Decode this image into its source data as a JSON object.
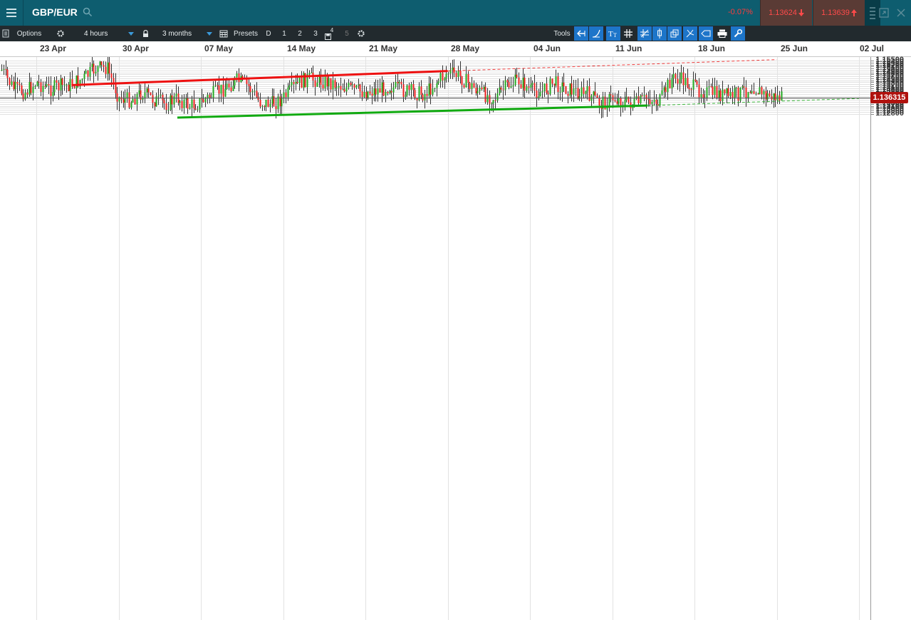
{
  "header": {
    "symbol": "GBP/EUR",
    "change": "-0.07%",
    "bid": "1.13624",
    "ask": "1.13639"
  },
  "toolbar": {
    "options_label": "Options",
    "interval_value": "4 hours",
    "range_value": "3 months",
    "presets_label": "Presets",
    "preset_buttons": [
      "D",
      "1",
      "2",
      "3",
      "4",
      "5"
    ],
    "tools_label": "Tools"
  },
  "date_axis": {
    "labels": [
      "23 Apr",
      "30 Apr",
      "07 May",
      "14 May",
      "21 May",
      "28 May",
      "04 Jun",
      "11 Jun",
      "18 Jun",
      "25 Jun",
      "02 Jul"
    ]
  },
  "price_axis": {
    "labels": [
      "1.15500",
      "1.15400",
      "1.15300",
      "1.15200",
      "1.15100",
      "1.15000",
      "1.14900",
      "1.14800",
      "1.14700",
      "1.14600",
      "1.14500",
      "1.14400",
      "1.14300",
      "1.14200",
      "1.14100",
      "1.14000",
      "1.13900",
      "1.13800",
      "1.13700",
      "1.13600",
      "1.13500",
      "1.13400",
      "1.13300",
      "1.13200",
      "1.13100",
      "1.13000",
      "1.12900",
      "1.12800"
    ],
    "current_price": "1.136315"
  },
  "chart_data": {
    "type": "candlestick",
    "instrument": "GBP/EUR",
    "interval": "4 hours",
    "range": "3 months",
    "ylim": [
      1.1275,
      1.1555
    ],
    "x_ticks": [
      "23 Apr",
      "30 Apr",
      "07 May",
      "14 May",
      "21 May",
      "28 May",
      "04 Jun",
      "11 Jun",
      "18 Jun",
      "25 Jun",
      "02 Jul"
    ],
    "last_price": 1.136315,
    "up_color": "#22aa22",
    "down_color": "#ee2222",
    "trendlines": [
      {
        "color": "#ee1111",
        "from": {
          "date": "26 Apr",
          "price": 1.1426
        },
        "to": {
          "date": "28 May",
          "price": 1.1497
        },
        "extended_to": {
          "date": "25 Jun",
          "price": 1.1555
        }
      },
      {
        "color": "#11aa11",
        "from": {
          "date": "05 May",
          "price": 1.1261
        },
        "to": {
          "date": "14 Jun",
          "price": 1.1322
        },
        "extended_to": {
          "date": "02 Jul",
          "price": 1.1358
        }
      }
    ],
    "path_points": [
      {
        "date": "19 Apr",
        "price": 1.147
      },
      {
        "date": "20 Apr",
        "price": 1.1505
      },
      {
        "date": "21 Apr",
        "price": 1.141
      },
      {
        "date": "22 Apr",
        "price": 1.139
      },
      {
        "date": "23 Apr",
        "price": 1.144
      },
      {
        "date": "24 Apr",
        "price": 1.1405
      },
      {
        "date": "25 Apr",
        "price": 1.142
      },
      {
        "date": "26 Apr",
        "price": 1.143
      },
      {
        "date": "27 Apr",
        "price": 1.146
      },
      {
        "date": "28 Apr",
        "price": 1.151
      },
      {
        "date": "29 Apr",
        "price": 1.1515
      },
      {
        "date": "30 Apr",
        "price": 1.136
      },
      {
        "date": "01 May",
        "price": 1.135
      },
      {
        "date": "02 May",
        "price": 1.139
      },
      {
        "date": "03 May",
        "price": 1.135
      },
      {
        "date": "04 May",
        "price": 1.133
      },
      {
        "date": "05 May",
        "price": 1.136
      },
      {
        "date": "06 May",
        "price": 1.132
      },
      {
        "date": "07 May",
        "price": 1.134
      },
      {
        "date": "08 May",
        "price": 1.138
      },
      {
        "date": "09 May",
        "price": 1.141
      },
      {
        "date": "10 May",
        "price": 1.145
      },
      {
        "date": "11 May",
        "price": 1.142
      },
      {
        "date": "12 May",
        "price": 1.134
      },
      {
        "date": "13 May",
        "price": 1.133
      },
      {
        "date": "14 May",
        "price": 1.136
      },
      {
        "date": "15 May",
        "price": 1.142
      },
      {
        "date": "16 May",
        "price": 1.146
      },
      {
        "date": "17 May",
        "price": 1.145
      },
      {
        "date": "18 May",
        "price": 1.144
      },
      {
        "date": "19 May",
        "price": 1.142
      },
      {
        "date": "20 May",
        "price": 1.14
      },
      {
        "date": "21 May",
        "price": 1.139
      },
      {
        "date": "22 May",
        "price": 1.14
      },
      {
        "date": "23 May",
        "price": 1.142
      },
      {
        "date": "24 May",
        "price": 1.14
      },
      {
        "date": "25 May",
        "price": 1.139
      },
      {
        "date": "26 May",
        "price": 1.138
      },
      {
        "date": "27 May",
        "price": 1.144
      },
      {
        "date": "28 May",
        "price": 1.149
      },
      {
        "date": "29 May",
        "price": 1.147
      },
      {
        "date": "30 May",
        "price": 1.142
      },
      {
        "date": "31 May",
        "price": 1.138
      },
      {
        "date": "01 Jun",
        "price": 1.136
      },
      {
        "date": "02 Jun",
        "price": 1.142
      },
      {
        "date": "03 Jun",
        "price": 1.145
      },
      {
        "date": "04 Jun",
        "price": 1.14
      },
      {
        "date": "05 Jun",
        "price": 1.139
      },
      {
        "date": "06 Jun",
        "price": 1.144
      },
      {
        "date": "07 Jun",
        "price": 1.141
      },
      {
        "date": "08 Jun",
        "price": 1.139
      },
      {
        "date": "09 Jun",
        "price": 1.138
      },
      {
        "date": "10 Jun",
        "price": 1.133
      },
      {
        "date": "11 Jun",
        "price": 1.136
      },
      {
        "date": "12 Jun",
        "price": 1.134
      },
      {
        "date": "13 Jun",
        "price": 1.133
      },
      {
        "date": "14 Jun",
        "price": 1.136
      },
      {
        "date": "15 Jun",
        "price": 1.134
      },
      {
        "date": "16 Jun",
        "price": 1.146
      },
      {
        "date": "17 Jun",
        "price": 1.145
      },
      {
        "date": "18 Jun",
        "price": 1.141
      },
      {
        "date": "19 Jun",
        "price": 1.139
      },
      {
        "date": "20 Jun",
        "price": 1.138
      },
      {
        "date": "21 Jun",
        "price": 1.137
      },
      {
        "date": "22 Jun",
        "price": 1.139
      },
      {
        "date": "23 Jun",
        "price": 1.142
      },
      {
        "date": "24 Jun",
        "price": 1.137
      },
      {
        "date": "25 Jun",
        "price": 1.1363
      }
    ]
  }
}
